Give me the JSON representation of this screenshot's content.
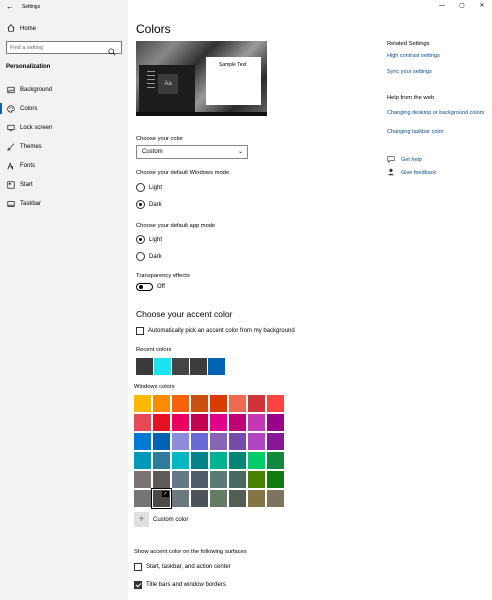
{
  "window": {
    "title": "Settings",
    "back_glyph": "←",
    "controls": [
      "—",
      "▢",
      "✕"
    ]
  },
  "sidebar": {
    "home_label": "Home",
    "home_icon": "home-icon",
    "search_placeholder": "Find a setting",
    "section_title": "Personalization",
    "items": [
      {
        "label": "Background",
        "icon": "image-icon"
      },
      {
        "label": "Colors",
        "icon": "palette-icon",
        "active": true
      },
      {
        "label": "Lock screen",
        "icon": "monitor-icon"
      },
      {
        "label": "Themes",
        "icon": "brush-icon"
      },
      {
        "label": "Fonts",
        "icon": "font-icon"
      },
      {
        "label": "Start",
        "icon": "start-icon"
      },
      {
        "label": "Taskbar",
        "icon": "taskbar-icon"
      }
    ]
  },
  "main": {
    "title": "Colors",
    "preview": {
      "sample_text": "Sample Text",
      "tile_label": "Aa"
    },
    "choose_color": {
      "label": "Choose your color",
      "value": "Custom"
    },
    "windows_mode": {
      "label": "Choose your default Windows mode",
      "options": [
        "Light",
        "Dark"
      ],
      "selected": "Dark"
    },
    "app_mode": {
      "label": "Choose your default app mode",
      "options": [
        "Light",
        "Dark"
      ],
      "selected": "Light"
    },
    "transparency": {
      "label": "Transparency effects",
      "state": "Off"
    },
    "accent": {
      "heading": "Choose your accent color",
      "auto_pick": {
        "label": "Automatically pick an accent color from my background",
        "checked": false
      },
      "recent_label": "Recent colors",
      "recent_colors": [
        "#3a3a3a",
        "#1de2f2",
        "#454545",
        "#3d3d3d",
        "#0063b1"
      ],
      "windows_label": "Windows colors",
      "windows_colors": [
        "#ffb900",
        "#ff8c00",
        "#f7630c",
        "#ca5010",
        "#da3b01",
        "#ef6950",
        "#d13438",
        "#ff4343",
        "#e74856",
        "#e81123",
        "#ea005e",
        "#c30052",
        "#e3008c",
        "#bf0077",
        "#c239b3",
        "#9a0089",
        "#0078d7",
        "#0063b1",
        "#8e8cd8",
        "#6b69d6",
        "#8764b8",
        "#744da9",
        "#b146c2",
        "#881798",
        "#0099bc",
        "#2d7d9a",
        "#00b7c3",
        "#038387",
        "#00b294",
        "#018574",
        "#00cc6a",
        "#10893e",
        "#7a7574",
        "#5d5a58",
        "#68768a",
        "#515c6b",
        "#567c73",
        "#486860",
        "#498205",
        "#107c10",
        "#767676",
        "#4c4a48",
        "#69797e",
        "#4a5459",
        "#647c64",
        "#525e54",
        "#847545",
        "#7e735f"
      ],
      "selected_index": 41,
      "custom_label": "Custom color",
      "surfaces_label": "Show accent color on the following surfaces",
      "surfaces": [
        {
          "label": "Start, taskbar, and action center",
          "checked": false
        },
        {
          "label": "Title bars and window borders",
          "checked": true
        }
      ]
    }
  },
  "right": {
    "related_heading": "Related Settings",
    "related_links": [
      "High contrast settings",
      "Sync your settings"
    ],
    "help_heading": "Help from the web",
    "help_links": [
      "Changing desktop or background colors",
      "Changing taskbar color"
    ],
    "support": [
      {
        "label": "Get help",
        "icon": "chat-icon"
      },
      {
        "label": "Give feedback",
        "icon": "feedback-icon"
      }
    ]
  }
}
